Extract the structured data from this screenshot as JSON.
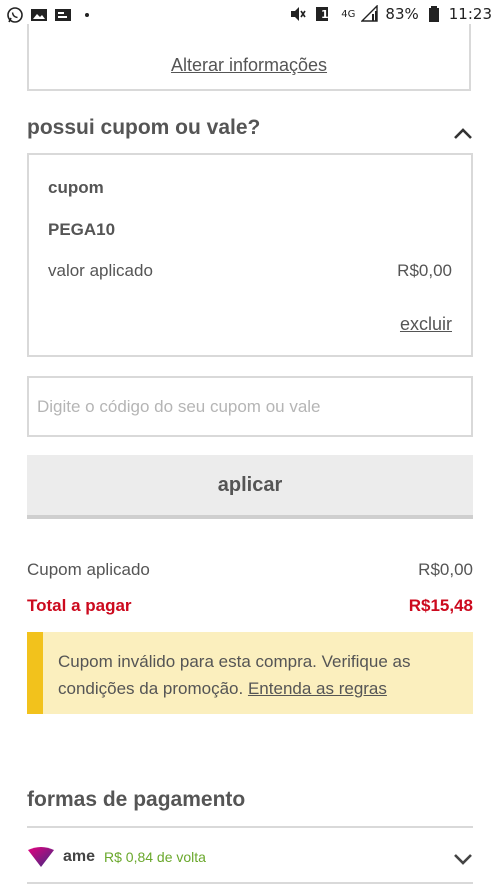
{
  "status_bar": {
    "left_icons": [
      "whatsapp-icon",
      "gallery-icon",
      "notification-icon",
      "dot-icon"
    ],
    "right_icons": [
      "mute-icon",
      "sim-icon",
      "network-4g-icon",
      "signal-icon",
      "battery-icon"
    ],
    "battery": "83%",
    "network": "4G",
    "sim": "1",
    "time": "11:23"
  },
  "address": {
    "change_link": "Alterar informações"
  },
  "coupon_section": {
    "title": "possui cupom ou vale?",
    "card": {
      "label": "cupom",
      "code": "PEGA10",
      "applied_label": "valor aplicado",
      "applied_value": "R$0,00",
      "remove": "excluir"
    },
    "input_placeholder": "Digite o código do seu cupom ou vale",
    "apply_button": "aplicar"
  },
  "summary": {
    "coupon_label": "Cupom aplicado",
    "coupon_value": "R$0,00",
    "total_label": "Total a pagar",
    "total_value": "R$15,48"
  },
  "alert": {
    "message": "Cupom inválido para esta compra. Verifique as condições da promoção.",
    "link": "Entenda as regras"
  },
  "payment": {
    "title": "formas de pagamento",
    "method_name": "ame",
    "method_cashback": "R$ 0,84 de volta"
  },
  "colors": {
    "accent_red": "#cc0a1e",
    "alert_bg": "#fbefbe",
    "alert_border": "#f2c21c",
    "cashback_green": "#6aa82c",
    "border_gray": "#d9d9d9"
  }
}
